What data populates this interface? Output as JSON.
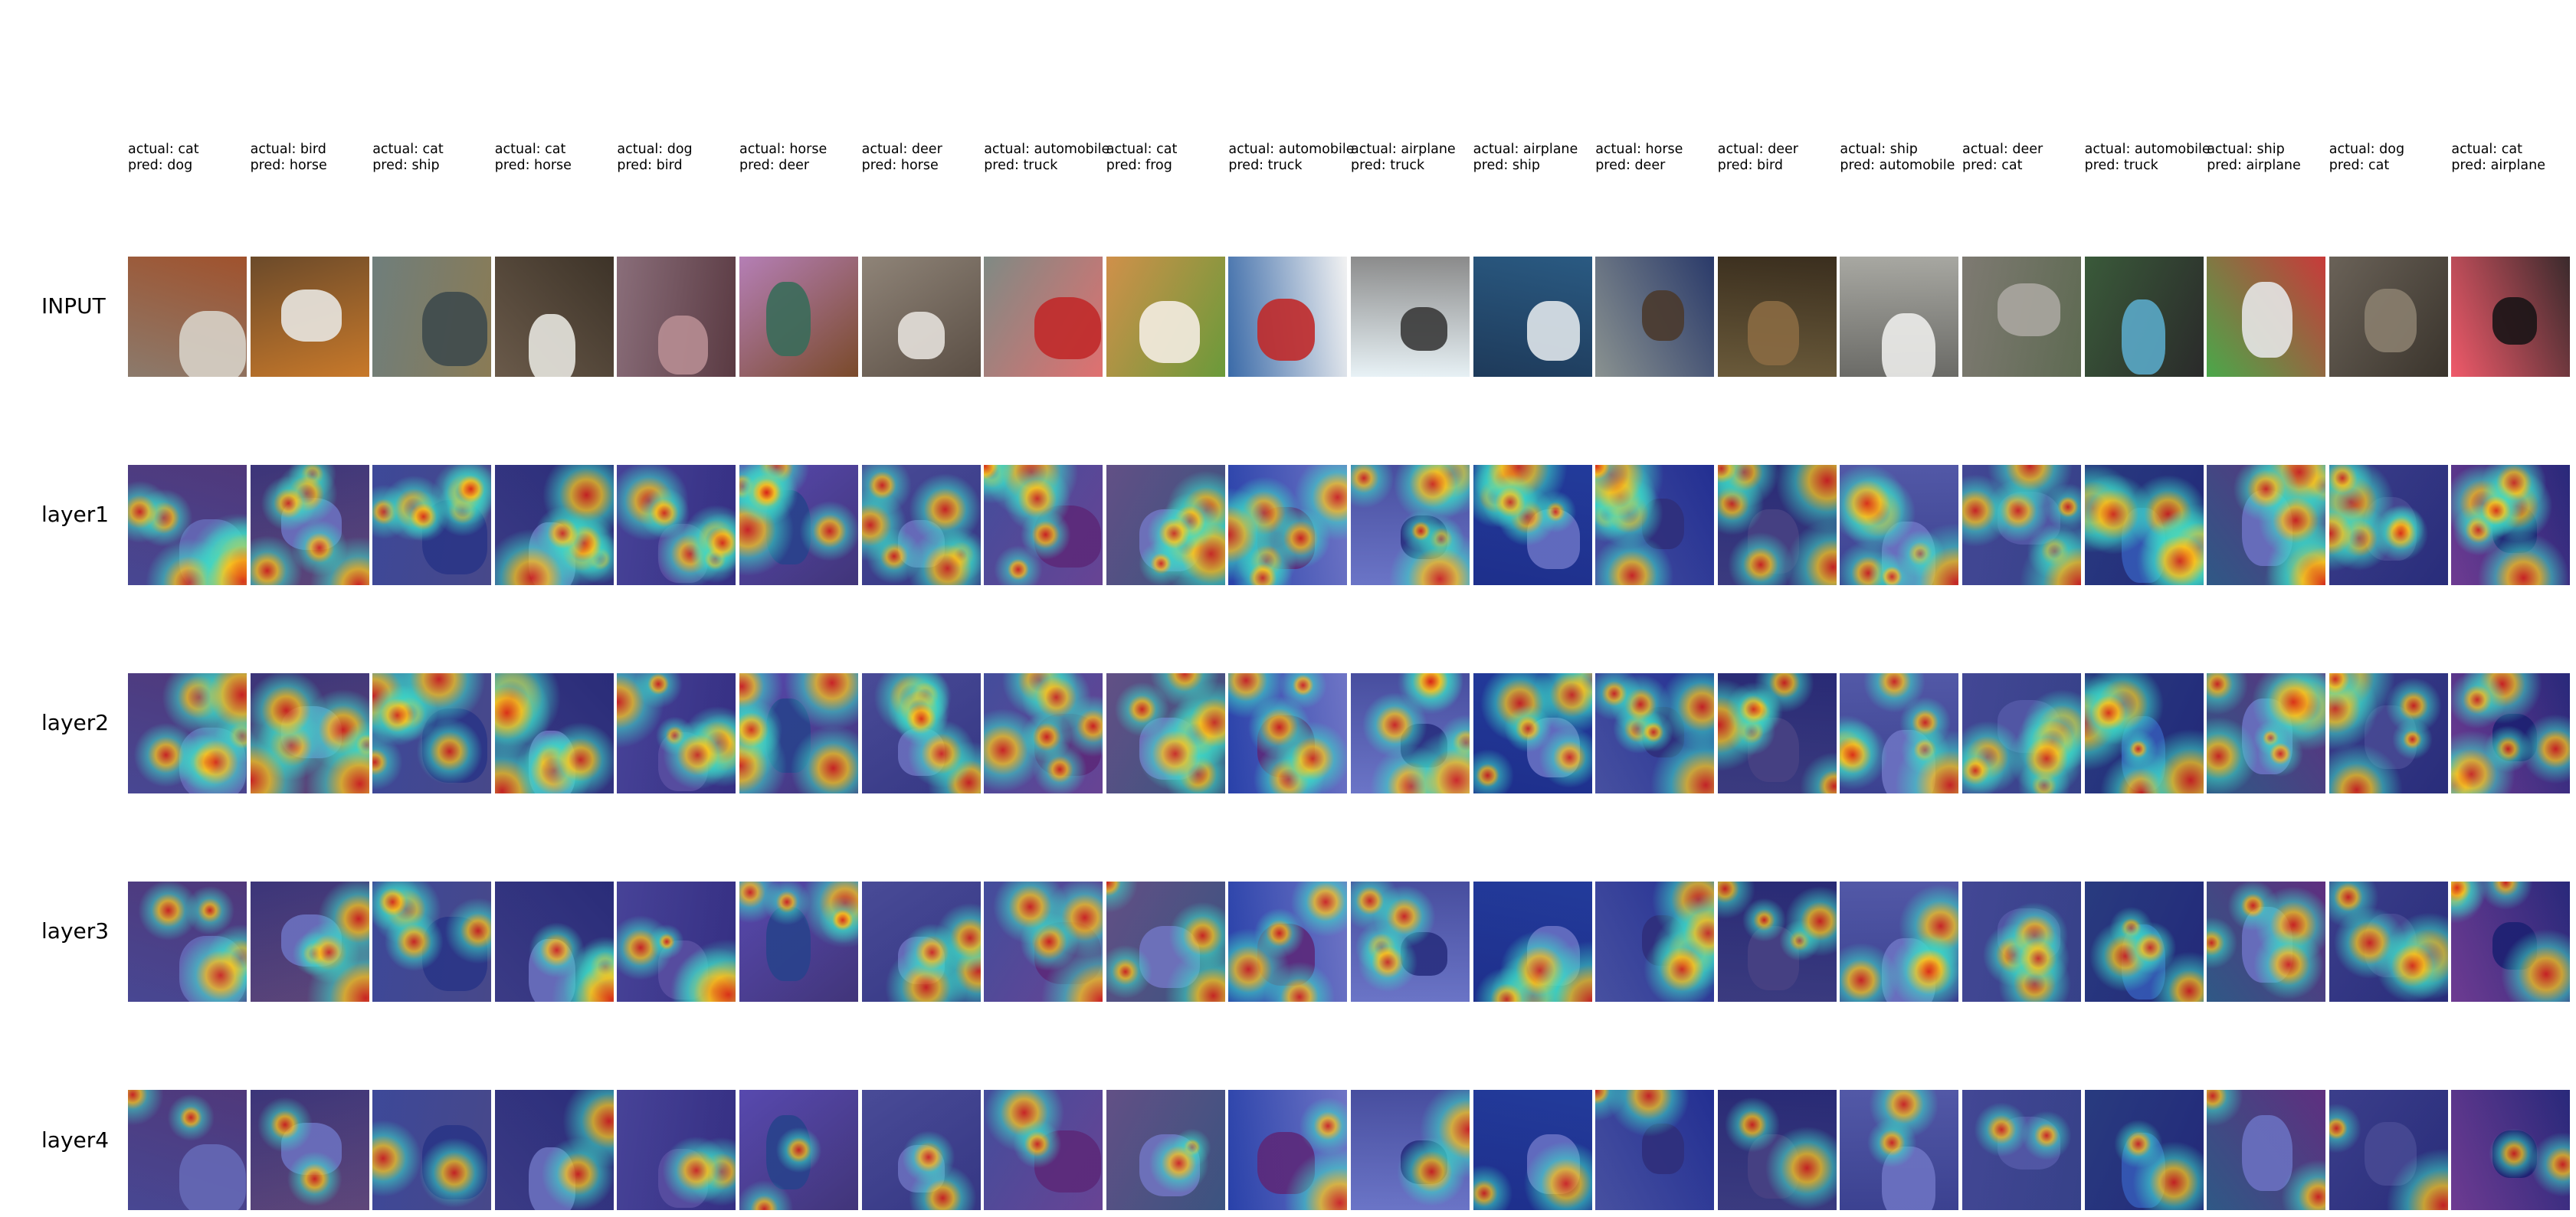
{
  "columns": [
    {
      "actual": "actual: cat",
      "pred": "pred: dog",
      "bg": "#8b7a6c",
      "fg": "#d7d2c8",
      "accent": "#a0522d"
    },
    {
      "actual": "actual: bird",
      "pred": "pred: horse",
      "bg": "#6b4a2a",
      "fg": "#e8e6e0",
      "accent": "#c8792a"
    },
    {
      "actual": "actual: cat",
      "pred": "pred: ship",
      "bg": "#6f7e7c",
      "fg": "#3e4a4c",
      "accent": "#8a7b55"
    },
    {
      "actual": "actual: cat",
      "pred": "pred: horse",
      "bg": "#6a5a4a",
      "fg": "#e6e4de",
      "accent": "#3d3328"
    },
    {
      "actual": "actual: dog",
      "pred": "pred: bird",
      "bg": "#8a6e7a",
      "fg": "#b78d92",
      "accent": "#5a3a42"
    },
    {
      "actual": "actual: horse",
      "pred": "pred: deer",
      "bg": "#b57fb6",
      "fg": "#3a6b5a",
      "accent": "#7a4a2a"
    },
    {
      "actual": "actual: deer",
      "pred": "pred: horse",
      "bg": "#8f8478",
      "fg": "#e4e0da",
      "accent": "#5a4e44"
    },
    {
      "actual": "actual: automobile",
      "pred": "pred: truck",
      "bg": "#7f8a84",
      "fg": "#c02a2a",
      "accent": "#e07070"
    },
    {
      "actual": "actual: cat",
      "pred": "pred: frog",
      "bg": "#d0904a",
      "fg": "#f4ece2",
      "accent": "#6a9a3a"
    },
    {
      "actual": "actual: automobile",
      "pred": "pred: truck",
      "bg": "#3a6aa8",
      "fg": "#c02a2a",
      "accent": "#f2f2f2"
    },
    {
      "actual": "actual: airplane",
      "pred": "pred: truck",
      "bg": "#e8f2f6",
      "fg": "#3a3a3a",
      "accent": "#8a8a8a"
    },
    {
      "actual": "actual: airplane",
      "pred": "pred: ship",
      "bg": "#1e3a5a",
      "fg": "#dfe6ea",
      "accent": "#2a5a82"
    },
    {
      "actual": "actual: horse",
      "pred": "pred: deer",
      "bg": "#8a9290",
      "fg": "#4a3a2e",
      "accent": "#2a3a6a"
    },
    {
      "actual": "actual: deer",
      "pred": "pred: bird",
      "bg": "#6a5a3a",
      "fg": "#8a6a42",
      "accent": "#3a2e1e"
    },
    {
      "actual": "actual: ship",
      "pred": "pred: automobile",
      "bg": "#a8a8a2",
      "fg": "#ececea",
      "accent": "#6a6a66"
    },
    {
      "actual": "actual: deer",
      "pred": "pred: cat",
      "bg": "#7e7a72",
      "fg": "#aaa6a0",
      "accent": "#5e6a52"
    },
    {
      "actual": "actual: automobile",
      "pred": "pred: truck",
      "bg": "#3a5a3a",
      "fg": "#5aa8c8",
      "accent": "#2a2a2a"
    },
    {
      "actual": "actual: ship",
      "pred": "pred: airplane",
      "bg": "#4aa84a",
      "fg": "#e6e6e6",
      "accent": "#c83a3a"
    },
    {
      "actual": "actual: dog",
      "pred": "pred: cat",
      "bg": "#6a6258",
      "fg": "#8a7e6e",
      "accent": "#3a342c"
    },
    {
      "actual": "actual: cat",
      "pred": "pred: airplane",
      "bg": "#f05a6a",
      "fg": "#1a1416",
      "accent": "#3a2a2c"
    }
  ],
  "rows": [
    {
      "label": "INPUT"
    },
    {
      "label": "layer1"
    },
    {
      "label": "layer2"
    },
    {
      "label": "layer3"
    },
    {
      "label": "layer4"
    }
  ]
}
